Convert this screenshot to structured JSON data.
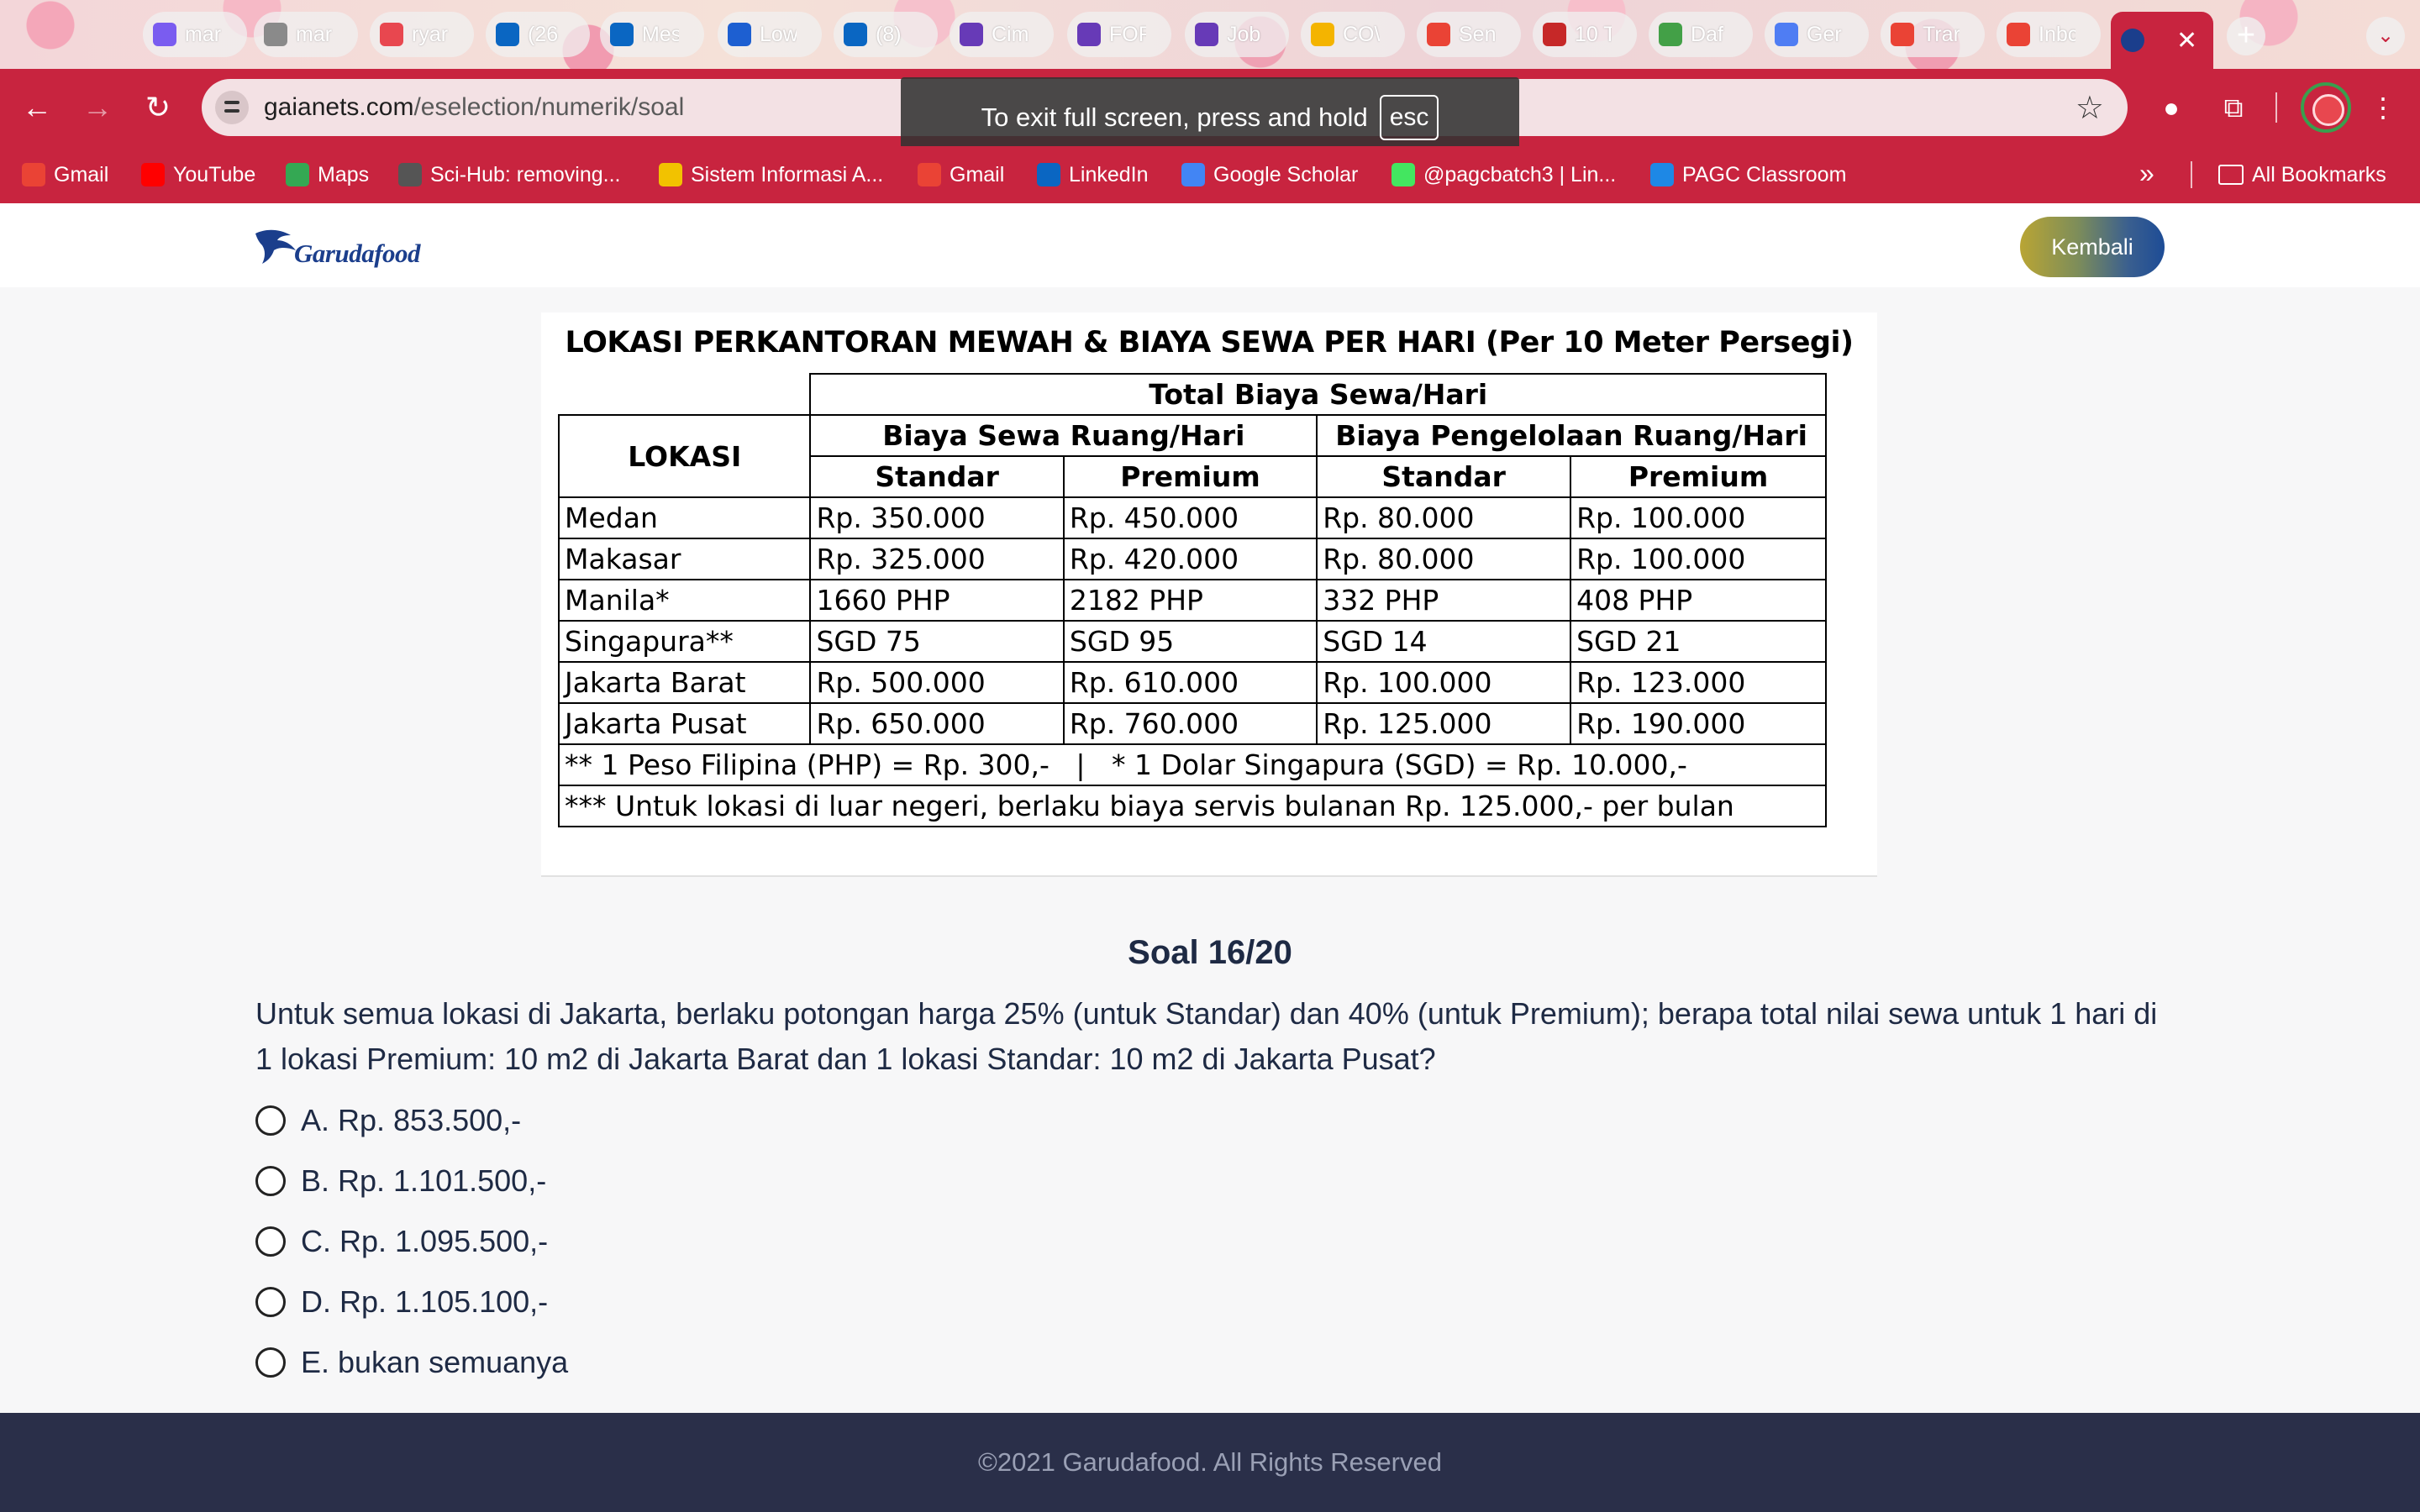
{
  "browser": {
    "tabs": [
      {
        "label": "mar",
        "icon": "dart-icon",
        "color": "#7a5cf0"
      },
      {
        "label": "mar",
        "icon": "globe-icon",
        "color": "#8a8a8a"
      },
      {
        "label": "ryar",
        "icon": "target-icon",
        "color": "#e8474f"
      },
      {
        "label": "(26",
        "icon": "linkedin-icon",
        "color": "#0a66c2"
      },
      {
        "label": "Mes",
        "icon": "linkedin-icon",
        "color": "#0a66c2"
      },
      {
        "label": "Low",
        "icon": "lowongan-icon",
        "color": "#1d5fd1"
      },
      {
        "label": "(8)",
        "icon": "linkedin-icon",
        "color": "#0a66c2"
      },
      {
        "label": "Cim",
        "icon": "forms-icon",
        "color": "#673ab7"
      },
      {
        "label": "FOR",
        "icon": "forms-icon",
        "color": "#673ab7"
      },
      {
        "label": "Job",
        "icon": "forms-icon",
        "color": "#673ab7"
      },
      {
        "label": "CO\\",
        "icon": "drive-icon",
        "color": "#f4b400"
      },
      {
        "label": "Sen",
        "icon": "gmail-icon",
        "color": "#ea4335"
      },
      {
        "label": "10 T",
        "icon": "hr-icon",
        "color": "#c62828"
      },
      {
        "label": "Daf",
        "icon": "check-icon",
        "color": "#43a047"
      },
      {
        "label": "Ger",
        "icon": "gemini-icon",
        "color": "#4f7df3"
      },
      {
        "label": "Trar",
        "icon": "gmail-icon",
        "color": "#ea4335"
      },
      {
        "label": "Inbc",
        "icon": "gmail-icon",
        "color": "#ea4335"
      }
    ],
    "url_host": "gaianets.com",
    "url_path": "/eselection/numerik/soal",
    "fullscreen_tip": "To exit full screen, press and hold",
    "fullscreen_key": "esc",
    "bookmarks": [
      {
        "label": "Gmail",
        "icon": "gmail-icon",
        "color": "#ea4335"
      },
      {
        "label": "YouTube",
        "icon": "youtube-icon",
        "color": "#ff0000"
      },
      {
        "label": "Maps",
        "icon": "maps-icon",
        "color": "#34a853"
      },
      {
        "label": "Sci-Hub: removing...",
        "icon": "scihub-icon",
        "color": "#555555"
      },
      {
        "label": "Sistem Informasi A...",
        "icon": "university-icon",
        "color": "#f2c200"
      },
      {
        "label": "Gmail",
        "icon": "gmail-icon",
        "color": "#ea4335"
      },
      {
        "label": "LinkedIn",
        "icon": "linkedin-icon",
        "color": "#0a66c2"
      },
      {
        "label": "Google Scholar",
        "icon": "scholar-icon",
        "color": "#4285f4"
      },
      {
        "label": "@pagcbatch3 | Lin...",
        "icon": "linktree-icon",
        "color": "#43e660"
      },
      {
        "label": "PAGC Classroom",
        "icon": "classroom-icon",
        "color": "#1e88e5"
      }
    ],
    "all_bookmarks_label": "All Bookmarks"
  },
  "header": {
    "logo_text": "Garudafood",
    "back_label": "Kembali"
  },
  "table": {
    "title": "LOKASI PERKANTORAN MEWAH & BIAYA SEWA PER HARI (Per 10 Meter Persegi)",
    "header_total": "Total Biaya Sewa/Hari",
    "header_location": "LOKASI",
    "header_rent": "Biaya Sewa Ruang/Hari",
    "header_management": "Biaya Pengelolaan Ruang/Hari",
    "header_standard": "Standar",
    "header_premium": "Premium",
    "rows": [
      {
        "location": "Medan",
        "rent_std": "Rp. 350.000",
        "rent_prem": "Rp. 450.000",
        "mgmt_std": "Rp. 80.000",
        "mgmt_prem": "Rp. 100.000"
      },
      {
        "location": "Makasar",
        "rent_std": "Rp. 325.000",
        "rent_prem": "Rp. 420.000",
        "mgmt_std": "Rp. 80.000",
        "mgmt_prem": "Rp. 100.000"
      },
      {
        "location": "Manila*",
        "rent_std": "1660 PHP",
        "rent_prem": "2182 PHP",
        "mgmt_std": "332 PHP",
        "mgmt_prem": "408 PHP"
      },
      {
        "location": "Singapura**",
        "rent_std": "SGD 75",
        "rent_prem": "SGD 95",
        "mgmt_std": "SGD 14",
        "mgmt_prem": "SGD 21"
      },
      {
        "location": "Jakarta Barat",
        "rent_std": "Rp. 500.000",
        "rent_prem": "Rp. 610.000",
        "mgmt_std": "Rp. 100.000",
        "mgmt_prem": "Rp. 123.000"
      },
      {
        "location": "Jakarta Pusat",
        "rent_std": "Rp. 650.000",
        "rent_prem": "Rp. 760.000",
        "mgmt_std": "Rp. 125.000",
        "mgmt_prem": "Rp. 190.000"
      }
    ],
    "note_currency": "** 1 Peso Filipina (PHP) = Rp. 300,-   |   * 1 Dolar Singapura (SGD) = Rp. 10.000,-",
    "note_service": "*** Untuk lokasi di luar negeri, berlaku biaya servis bulanan Rp. 125.000,- per bulan"
  },
  "question": {
    "title": "Soal 16/20",
    "text": "Untuk semua lokasi di Jakarta, berlaku potongan harga 25% (untuk Standar) dan 40% (untuk Premium); berapa total nilai sewa untuk 1 hari di 1 lokasi Premium: 10 m2 di Jakarta Barat dan 1 lokasi Standar: 10 m2 di Jakarta Pusat?",
    "options": [
      "A. Rp. 853.500,-",
      "B. Rp. 1.101.500,-",
      "C. Rp. 1.095.500,-",
      "D. Rp. 1.105.100,-",
      "E. bukan semuanya"
    ]
  },
  "footer": {
    "copyright": "©2021 Garudafood. All Rights Reserved"
  }
}
